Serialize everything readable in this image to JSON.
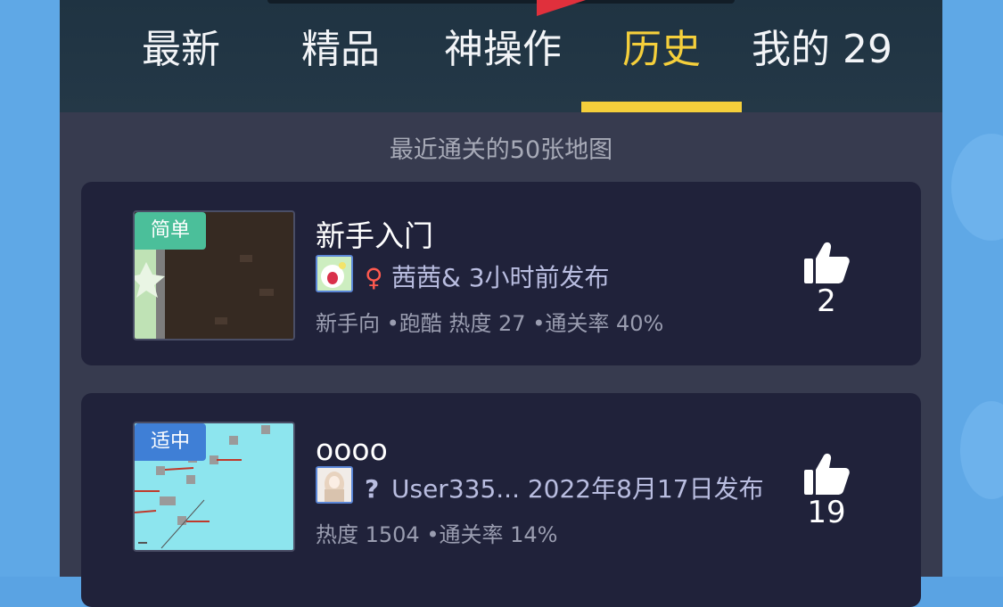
{
  "tabs": [
    {
      "label": "最新"
    },
    {
      "label": "精品"
    },
    {
      "label": "神操作"
    },
    {
      "label": "历史"
    },
    {
      "label": "我的 29"
    }
  ],
  "active_tab_index": 3,
  "subtitle": "最近通关的50张地图",
  "maps": [
    {
      "difficulty": "简单",
      "difficulty_color": "#4bbf9a",
      "title": "新手入门",
      "gender_icon": "female-icon",
      "gender_symbol": "♀",
      "gender_color": "#ff5a4f",
      "author_text": "茜茜& 3小时前发布",
      "meta_text": "新手向 •跑酷 热度 27 •通关率 40%",
      "likes": "2"
    },
    {
      "difficulty": "适中",
      "difficulty_color": "#3f7fd6",
      "title": "oooo",
      "gender_icon": "unknown-gender-icon",
      "gender_symbol": "?",
      "gender_color": "#b9bde0",
      "author_text": "User335... 2022年8月17日发布",
      "meta_text": "热度 1504 •通关率 14%",
      "likes": "19"
    }
  ],
  "colors": {
    "accent": "#f5cf3b",
    "panel_bg": "#373b4f",
    "card_bg": "#20223a",
    "topbar_bg": "#22364a",
    "side_bg": "#5fa8e6"
  }
}
